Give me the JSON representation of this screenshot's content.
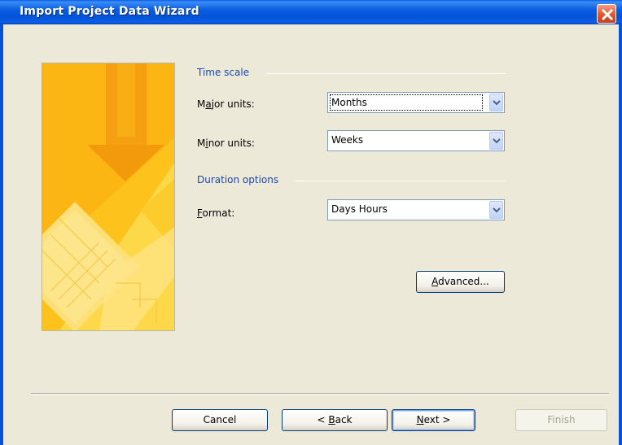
{
  "window": {
    "title": "Import Project Data Wizard"
  },
  "time_scale": {
    "group_label": "Time scale",
    "major_units": {
      "label_prefix": "M",
      "label_ul": "a",
      "label_suffix": "jor units:",
      "value": "Months"
    },
    "minor_units": {
      "label_prefix": "M",
      "label_ul": "i",
      "label_suffix": "nor units:",
      "value": "Weeks"
    }
  },
  "duration": {
    "group_label": "Duration options",
    "format": {
      "label_ul": "F",
      "label_suffix": "ormat:",
      "value": "Days Hours"
    }
  },
  "buttons": {
    "advanced": {
      "ul": "A",
      "rest": "dvanced..."
    },
    "cancel": "Cancel",
    "back": {
      "prefix": "< ",
      "ul": "B",
      "rest": "ack"
    },
    "next": {
      "ul": "N",
      "rest": "ext >"
    },
    "finish": "Finish"
  },
  "colors": {
    "title_bar": "#0553d8",
    "group_label": "#1c47a8",
    "banner": "#fcc01a"
  }
}
